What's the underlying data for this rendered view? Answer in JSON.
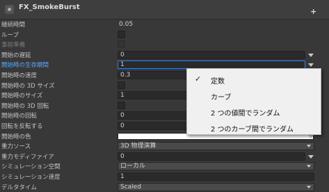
{
  "header": {
    "title": "FX_SmokeBurst"
  },
  "rows": [
    {
      "label": "継続時間",
      "value": "0.05"
    },
    {
      "label": "ループ"
    },
    {
      "label": "事前準備"
    },
    {
      "label": "開始の遅延",
      "value": "0"
    },
    {
      "label": "開始時の生存期間",
      "value": "1"
    },
    {
      "label": "開始時の速度",
      "value": "0.3"
    },
    {
      "label": "開始時の 3D サイズ"
    },
    {
      "label": "開始時のサイズ",
      "value": "1"
    },
    {
      "label": "開始時の 3D 回転"
    },
    {
      "label": "開始時の回転",
      "value": "0"
    },
    {
      "label": "回転を反転する",
      "value": "0"
    },
    {
      "label": "開始時の色"
    },
    {
      "label": "重力ソース",
      "value": "3D 物理演算"
    },
    {
      "label": "重力モディファイア",
      "value": "0"
    },
    {
      "label": "シミュレーション空間",
      "value": "ローカル"
    },
    {
      "label": "シミュレーション速度",
      "value": "1"
    },
    {
      "label": "デルタタイム",
      "value": "Scaled"
    }
  ],
  "popup": {
    "check_glyph": "✓",
    "items": [
      {
        "label": "定数"
      },
      {
        "label": "カーブ"
      },
      {
        "label": "2 つの値間でランダム"
      },
      {
        "label": "2 つのカーブ間でランダム"
      }
    ]
  }
}
